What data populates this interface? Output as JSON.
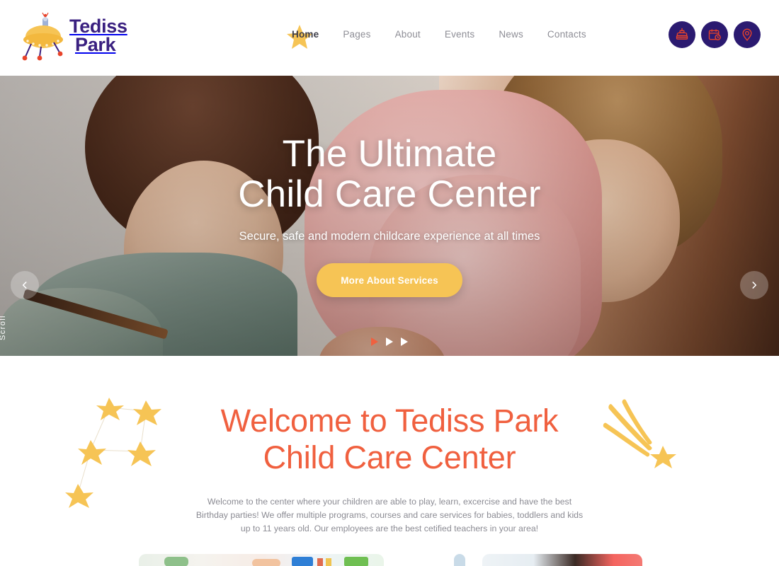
{
  "brand": {
    "logo_line1": "Tediss",
    "logo_line2": "Park",
    "logo_icon": "ufo-icon",
    "logo_text_color": "#3a2080",
    "logo_dome_color": "#f6c455"
  },
  "header": {
    "nav": [
      {
        "label": "Home",
        "active": true
      },
      {
        "label": "Pages",
        "active": false
      },
      {
        "label": "About",
        "active": false
      },
      {
        "label": "Events",
        "active": false
      },
      {
        "label": "News",
        "active": false
      },
      {
        "label": "Contacts",
        "active": false
      }
    ],
    "actions": [
      {
        "icon": "birthday-cake-icon",
        "title": "Birthday"
      },
      {
        "icon": "calendar-clock-icon",
        "title": "Schedule"
      },
      {
        "icon": "location-pin-icon",
        "title": "Location"
      }
    ],
    "action_bg": "#2b1a70",
    "action_icon_color": "#e8432a",
    "active_star_color": "#f6c455"
  },
  "hero": {
    "title_line1": "The Ultimate",
    "title_line2": "Child Care Center",
    "subtitle": "Secure, safe and modern childcare experience at all times",
    "cta_label": "More About Services",
    "cta_color": "#f6c455",
    "scroll_label": "Scroll",
    "prev_icon": "chevron-left-icon",
    "next_icon": "chevron-right-icon",
    "slides": [
      {
        "active": true
      },
      {
        "active": false
      },
      {
        "active": false
      }
    ],
    "active_dot_color": "#f0603f",
    "idle_dot_color": "#ffffff"
  },
  "welcome": {
    "title_line1": "Welcome to Tediss Park",
    "title_line2": "Child Care Center",
    "title_color": "#f0603f",
    "paragraph": "Welcome to the center where your children are able to play, learn, excercise and have the best Birthday parties! We offer multiple programs, courses and care services for babies, toddlers and kids up to 11 years old. Our employees are the best cetified teachers in your area!",
    "decoration_left": "star-constellation-icon",
    "decoration_right": "shooting-star-icon",
    "decoration_color": "#f6c455"
  },
  "cards": [
    {
      "name": "program-card-left"
    },
    {
      "name": "program-card-right"
    }
  ]
}
